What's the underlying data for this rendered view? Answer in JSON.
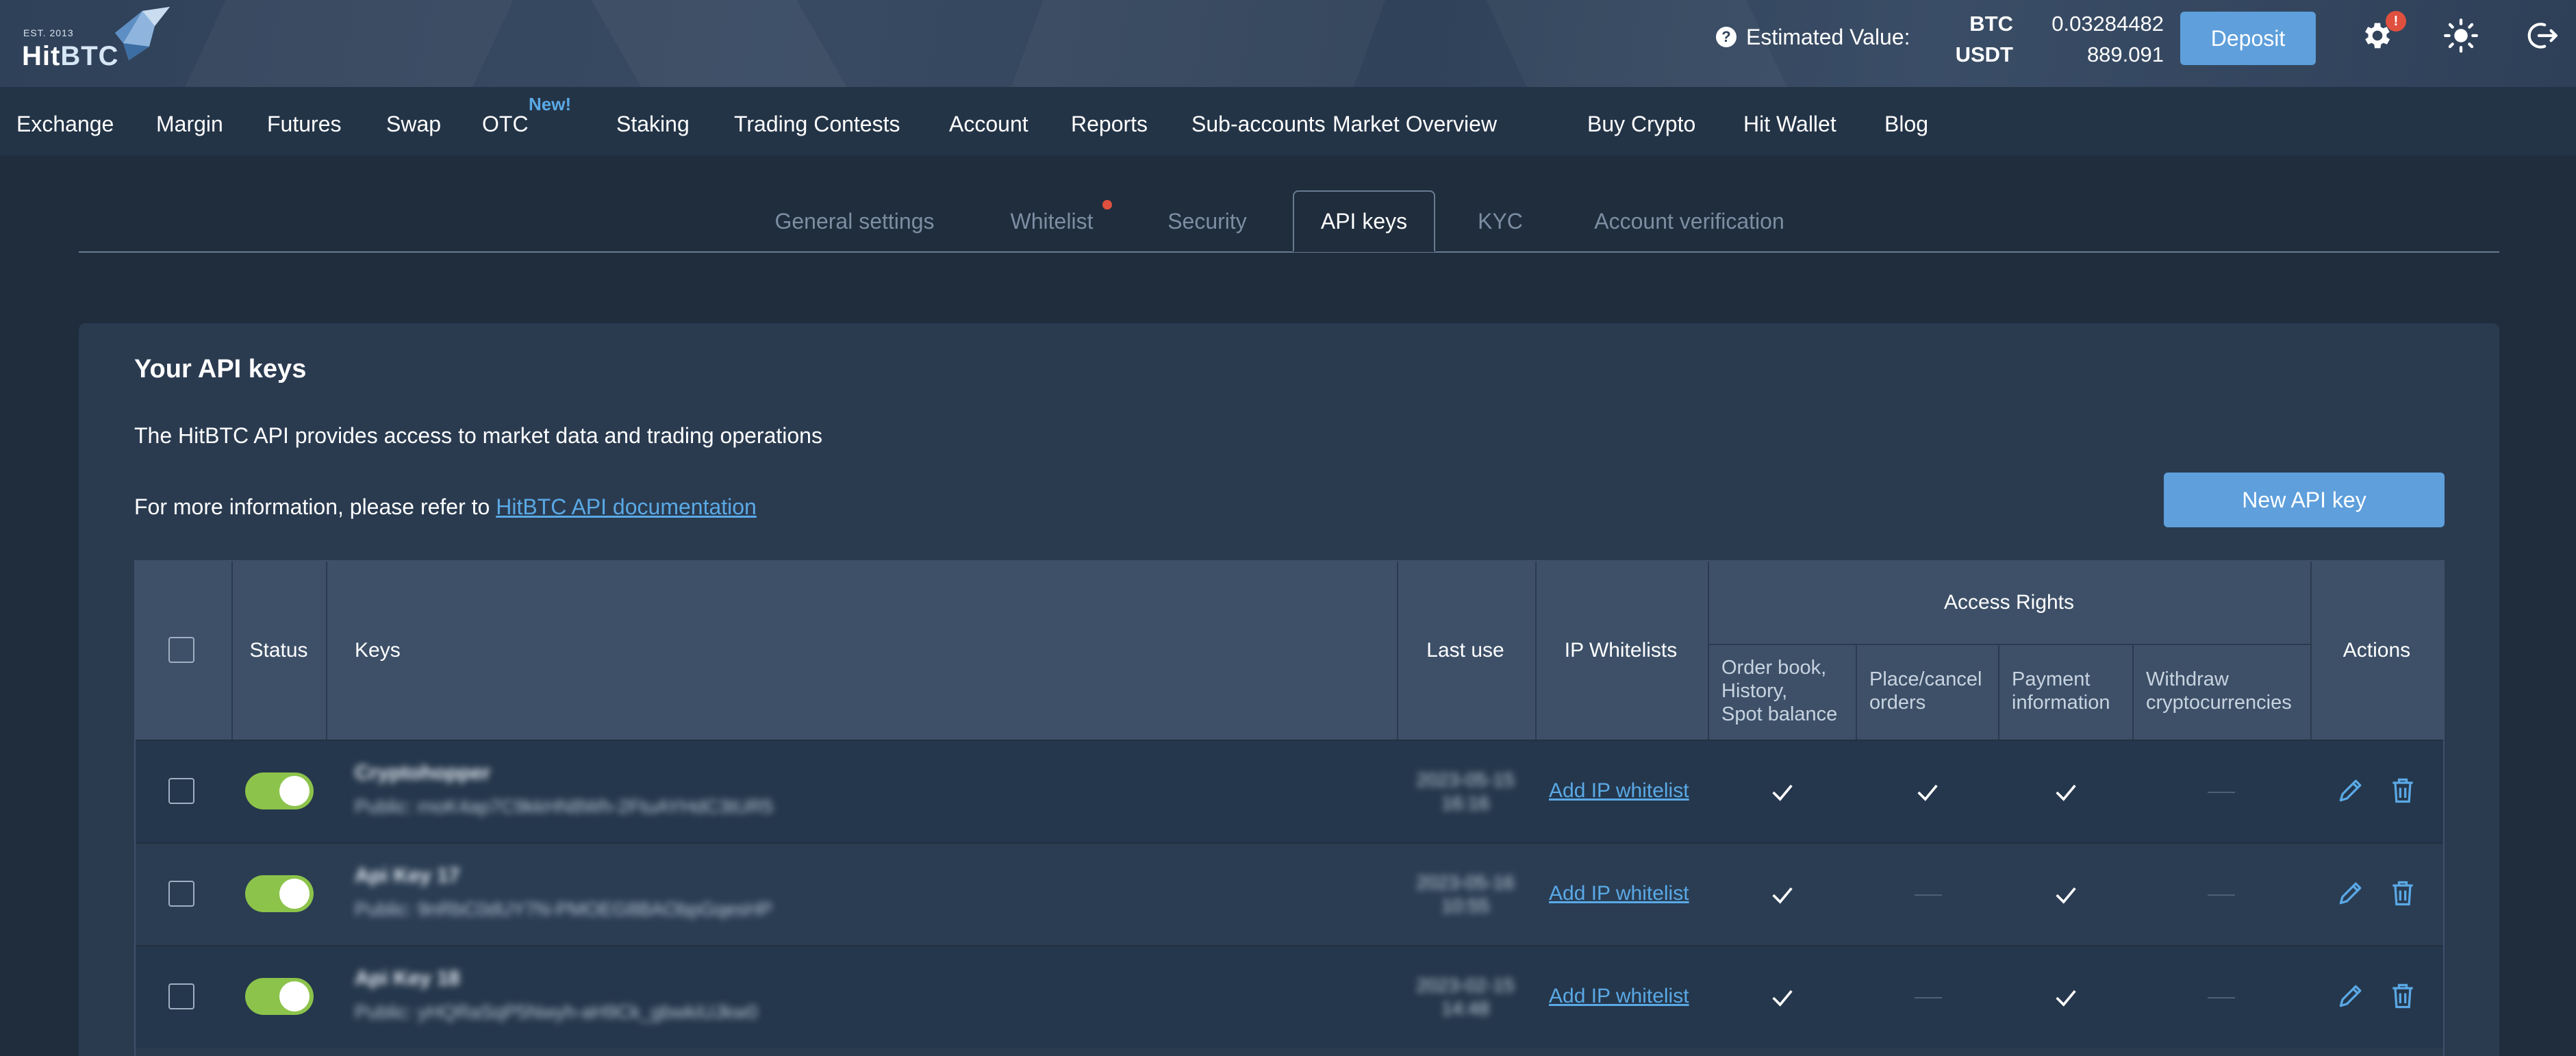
{
  "logo": {
    "est": "EST. 2013",
    "name_hit": "Hit",
    "name_btc": "BTC"
  },
  "header": {
    "estimated_label": "Estimated Value:",
    "balances": [
      {
        "code": "BTC",
        "value": "0.03284482"
      },
      {
        "code": "USDT",
        "value": "889.091"
      }
    ],
    "deposit_label": "Deposit",
    "settings_badge": "!"
  },
  "nav": {
    "items": [
      "Exchange",
      "Margin",
      "Futures",
      "Swap",
      "OTC",
      "Staking",
      "Trading Contests",
      "Account",
      "Reports",
      "Sub-accounts",
      "Market Overview",
      "Buy Crypto",
      "Hit Wallet",
      "Blog"
    ],
    "otc_badge": "New!"
  },
  "tabs": [
    "General settings",
    "Whitelist",
    "Security",
    "API keys",
    "KYC",
    "Account verification"
  ],
  "active_tab": "API keys",
  "card": {
    "title": "Your API keys",
    "description": "The HitBTC API provides access to market data and trading operations",
    "more_prefix": "For more information, please refer to ",
    "more_link": "HitBTC API documentation",
    "new_key_button": "New API key"
  },
  "table": {
    "headers": {
      "status": "Status",
      "keys": "Keys",
      "last_use": "Last use",
      "ip_whitelists": "IP Whitelists",
      "access_rights": "Access Rights",
      "rights": [
        "Order book,\nHistory,\nSpot balance",
        "Place/cancel\norders",
        "Payment\ninformation",
        "Withdraw\ncryptocurrencies"
      ],
      "actions": "Actions"
    },
    "rows": [
      {
        "name": "Cryptohopper",
        "public": "Public: rnoK4ap7C9kkHN8Wh-2FtuAYHdC3tUR5",
        "last_use": "2023-05-15\n16:16",
        "ip_link": "Add IP whitelist",
        "rights": [
          true,
          true,
          true,
          false
        ],
        "enabled": true
      },
      {
        "name": "Api Key 17",
        "public": "Public: 9nRbC0dUY7N-PMOEG8BAObpGqesHP",
        "last_use": "2023-05-16\n10:55",
        "ip_link": "Add IP whitelist",
        "rights": [
          true,
          false,
          true,
          false
        ],
        "enabled": true
      },
      {
        "name": "Api Key 18",
        "public": "Public: yHQRaSqP5Nwyh-aH9Ck_gbwkiUJkw0",
        "last_use": "2023-02-15\n14:48",
        "ip_link": "Add IP whitelist",
        "rights": [
          true,
          false,
          true,
          false
        ],
        "enabled": true
      }
    ]
  }
}
